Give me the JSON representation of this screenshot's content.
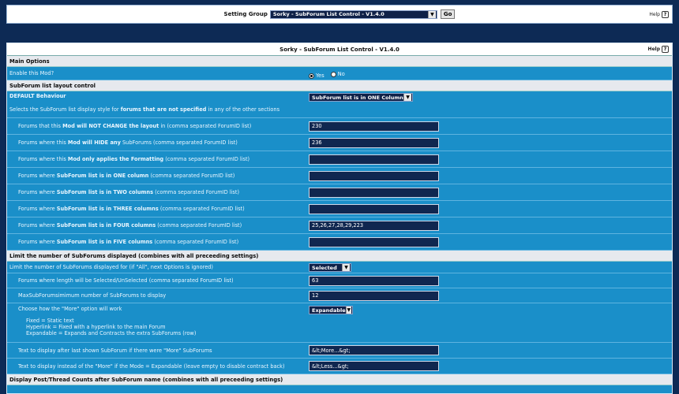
{
  "setting_group": {
    "label": "Setting Group",
    "selected": "Sorky - SubForum List Control - V1.4.0",
    "go_label": "Go",
    "help_label": "Help"
  },
  "panel": {
    "title": "Sorky - SubForum List Control - V1.4.0",
    "help_label": "Help"
  },
  "main_options": {
    "header": "Main Options",
    "enable_label": "Enable this Mod?",
    "yes_label": "Yes",
    "no_label": "No",
    "enabled": true
  },
  "layout": {
    "header": "SubForum list layout control",
    "default_title": "DEFAULT Behaviour",
    "default_select": "SubForum list is in ONE Column",
    "default_desc_1": "Selects the SubForum list display style for ",
    "default_desc_bold": "forums that are not specified",
    "default_desc_2": " in any of the other sections",
    "rows": [
      {
        "pre": "Forums that this ",
        "bold": "Mod will NOT CHANGE the layout",
        "post": " in (comma separated ForumID list)",
        "value": "230"
      },
      {
        "pre": "Forums where this ",
        "bold": "Mod will HIDE any",
        "post": " SubForums (comma separated ForumID list)",
        "value": "236"
      },
      {
        "pre": "Forums where this ",
        "bold": "Mod only applies the Formatting",
        "post": " (comma separated ForumID list)",
        "value": ""
      },
      {
        "pre": "Forums where ",
        "bold": "SubForum list is in ONE column",
        "post": " (comma separated ForumID list)",
        "value": ""
      },
      {
        "pre": "Forums where ",
        "bold": "SubForum list is in TWO columns",
        "post": " (comma separated ForumID list)",
        "value": ""
      },
      {
        "pre": "Forums where ",
        "bold": "SubForum list is in THREE columns",
        "post": " (comma separated ForumID list)",
        "value": ""
      },
      {
        "pre": "Forums where ",
        "bold": "SubForum list is in FOUR columns",
        "post": " (comma separated ForumID list)",
        "value": "25,26,27,28,29,223"
      },
      {
        "pre": "Forums where ",
        "bold": "SubForum list is in FIVE columns",
        "post": " (comma separated ForumID list)",
        "value": ""
      }
    ]
  },
  "limit": {
    "header": "Limit the number of SubForums displayed (combines with all preceeding settings)",
    "limit_label": "Limit the number of SubForums displayed for (if \"All\", next Options is ignored)",
    "limit_select": "Selected",
    "length_label": "Forums where length will be Selected/UnSelected (comma separated ForumID list)",
    "length_value": "63",
    "max_label": "MaxSubForumsimimum number of SubForums to display",
    "max_value": "12",
    "more_label": "Choose how the \"More\" option will work",
    "more_select": "Expandable",
    "more_fixed": "Fixed = Static text",
    "more_hyperlink": "Hyperlink = Fixed with a hyperlink to the main Forum",
    "more_expandable": "Expandable = Expands and Contracts the extra SubForums (row)",
    "after_label": "Text to display after last shown SubForum if there were \"More\" SubForums",
    "after_value": "&lt;More...&gt;",
    "instead_label": "Text to display instead of the \"More\" if the Mode = Expandable (leave empty to disable contract back)",
    "instead_value": "&lt;Less...&gt;"
  },
  "counts": {
    "header": "Display Post/Thread Counts after SubForum name (combines with all preceeding settings)"
  },
  "icons": {
    "help": "help-icon",
    "dropdown": "chevron-down-icon"
  }
}
